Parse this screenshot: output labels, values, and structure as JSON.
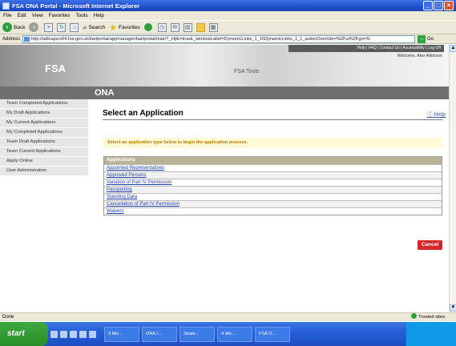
{
  "window": {
    "title": "FSA ONA Portal - Microsoft Internet Explorer",
    "minimize": "_",
    "maximize": "□",
    "close": "×"
  },
  "menu": [
    "File",
    "Edit",
    "View",
    "Favorites",
    "Tools",
    "Help"
  ],
  "toolbar": {
    "back": "Back",
    "search": "Search",
    "favorites": "Favorites"
  },
  "address": {
    "label": "Address",
    "url": "http://adtcapsrv04.fsa.gov.uk/bartportal/appmanager/bartportal/main?_nfpb=true&_windowLabel=DynamicLinks_1_16DynamicLinks_1_1_actionOverride=%2Fui%2Fgo=%",
    "go": "Go"
  },
  "header": {
    "logo_text": "FSA",
    "tools_label": "FSA Tools",
    "top_links": "Help | FAQ | Contact Us | Accessibility | Log Off",
    "welcome": "Welcome, Alex Atkinson",
    "section": "ONA"
  },
  "sidebar": {
    "items": [
      "Team Completed Applications",
      "My Draft Applications",
      "My Current Applications",
      "My Completed Applications",
      "Team Draft Applications",
      "Team Current Applications",
      "Apply Online",
      "User Administration"
    ]
  },
  "main": {
    "title": "Select an Application",
    "help": "Help",
    "instruction": "Select an application type below to begin the application process.",
    "table_header": "Applications",
    "applications": [
      "Appointed Representatives",
      "Approved Persons",
      "Variation of Part IV Permission",
      "Passporting",
      "Standing Data",
      "Cancellation of Part IV Permission",
      "Waivers"
    ],
    "cancel": "Cancel"
  },
  "status": {
    "left": "Done",
    "zone": "Trusted sites"
  },
  "taskbar": {
    "start": "start",
    "tasks": [
      "3 Mic...",
      "ONA I...",
      "Strate...",
      "4 Mic...",
      "FSA O..."
    ]
  }
}
